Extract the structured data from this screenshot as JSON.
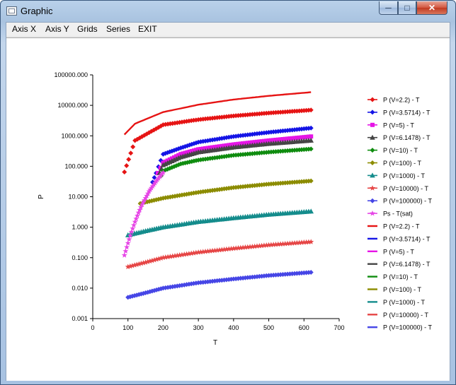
{
  "window": {
    "title": "Graphic"
  },
  "title_controls": {
    "minimize": "─",
    "maximize": "□",
    "close": "✕"
  },
  "menu": [
    "Axis X",
    "Axis Y",
    "Grids",
    "Series",
    "EXIT"
  ],
  "chart_data": {
    "type": "scatter",
    "xlabel": "T",
    "ylabel": "P",
    "xlim": [
      0,
      700
    ],
    "ylim": [
      0.001,
      100000
    ],
    "yscale": "log",
    "x_ticks": [
      "0",
      "100",
      "200",
      "300",
      "400",
      "500",
      "600",
      "700"
    ],
    "y_ticks": [
      "0.001",
      "0.010",
      "0.100",
      "1.000",
      "10.000",
      "100.000",
      "1000.000",
      "10000.000",
      "100000.000"
    ],
    "grid": false,
    "legend_position": "right",
    "series": [
      {
        "name": "P (V=2.2) - T",
        "color": "#e61414",
        "marker": "diamond",
        "x": [
          90,
          120,
          200,
          300,
          400,
          500,
          620
        ],
        "y": [
          65,
          700,
          2300,
          3400,
          4500,
          5600,
          7000
        ]
      },
      {
        "name": "P (V=3.5714) - T",
        "color": "#1414e6",
        "marker": "diamond",
        "x": [
          170,
          180,
          200,
          250,
          300,
          400,
          500,
          620
        ],
        "y": [
          30,
          60,
          250,
          400,
          620,
          950,
          1300,
          1800
        ]
      },
      {
        "name": "P (V=5) - T",
        "color": "#e614e6",
        "marker": "square",
        "x": [
          185,
          200,
          250,
          300,
          400,
          500,
          620
        ],
        "y": [
          60,
          130,
          250,
          360,
          520,
          700,
          950
        ]
      },
      {
        "name": "P (V=6.1478) - T",
        "color": "#454545",
        "marker": "triangle",
        "x": [
          190,
          200,
          250,
          300,
          400,
          500,
          620
        ],
        "y": [
          60,
          110,
          200,
          290,
          420,
          550,
          700
        ]
      },
      {
        "name": "P (V=10) - T",
        "color": "#0f8c0f",
        "marker": "diamond",
        "x": [
          195,
          200,
          250,
          300,
          400,
          500,
          620
        ],
        "y": [
          50,
          70,
          120,
          160,
          230,
          290,
          370
        ]
      },
      {
        "name": "P (V=100) - T",
        "color": "#8c8c00",
        "marker": "diamond",
        "x": [
          135,
          200,
          300,
          400,
          500,
          620
        ],
        "y": [
          6,
          9,
          14,
          20,
          26,
          33
        ]
      },
      {
        "name": "P (V=1000) - T",
        "color": "#148c8c",
        "marker": "triangle",
        "x": [
          100,
          150,
          200,
          300,
          400,
          500,
          620
        ],
        "y": [
          0.55,
          0.75,
          1.0,
          1.5,
          2.0,
          2.6,
          3.3
        ]
      },
      {
        "name": "P (V=10000) - T",
        "color": "#e64646",
        "marker": "star",
        "x": [
          100,
          150,
          200,
          300,
          400,
          500,
          620
        ],
        "y": [
          0.05,
          0.07,
          0.1,
          0.15,
          0.2,
          0.26,
          0.33
        ]
      },
      {
        "name": "P (V=100000) - T",
        "color": "#4646e6",
        "marker": "diamond",
        "x": [
          100,
          150,
          200,
          300,
          400,
          500,
          620
        ],
        "y": [
          0.005,
          0.007,
          0.01,
          0.015,
          0.02,
          0.026,
          0.033
        ]
      },
      {
        "name": "Ps - T(sat)",
        "color": "#e646e6",
        "marker": "star",
        "x": [
          90,
          100,
          110,
          120,
          130,
          140,
          150,
          160,
          170,
          180,
          190,
          200
        ],
        "y": [
          0.12,
          0.3,
          0.7,
          1.5,
          3,
          5.5,
          9,
          15,
          22,
          32,
          45,
          62
        ]
      },
      {
        "name": "P (V=2.2) - T",
        "color": "#e61414",
        "marker": "line",
        "x": [
          90,
          120,
          200,
          300,
          400,
          500,
          620
        ],
        "y": [
          1100,
          2500,
          6000,
          10500,
          15500,
          20500,
          27000
        ]
      },
      {
        "name": "P (V=3.5714) - T",
        "color": "#1414e6",
        "marker": "line",
        "x": [],
        "y": []
      },
      {
        "name": "P (V=5) - T",
        "color": "#e614e6",
        "marker": "line",
        "x": [],
        "y": []
      },
      {
        "name": "P (V=6.1478) - T",
        "color": "#454545",
        "marker": "line",
        "x": [],
        "y": []
      },
      {
        "name": "P (V=10) - T",
        "color": "#0f8c0f",
        "marker": "line",
        "x": [],
        "y": []
      },
      {
        "name": "P (V=100) - T",
        "color": "#8c8c00",
        "marker": "line",
        "x": [],
        "y": []
      },
      {
        "name": "P (V=1000) - T",
        "color": "#148c8c",
        "marker": "line",
        "x": [],
        "y": []
      },
      {
        "name": "P (V=10000) - T",
        "color": "#e64646",
        "marker": "line",
        "x": [],
        "y": []
      },
      {
        "name": "P (V=100000) - T",
        "color": "#4646e6",
        "marker": "line",
        "x": [],
        "y": []
      }
    ]
  }
}
